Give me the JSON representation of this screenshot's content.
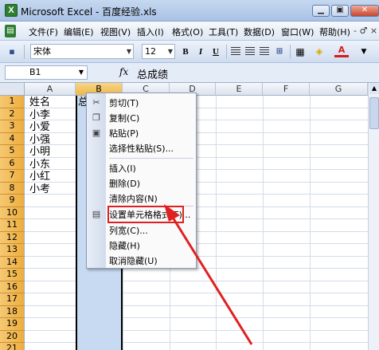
{
  "window": {
    "title": "Microsoft Excel - 百度经验.xls",
    "app_icon": "excel-icon",
    "controls": [
      "minimize",
      "restore",
      "close"
    ]
  },
  "menubar": {
    "items": [
      {
        "label": "文件(F)"
      },
      {
        "label": "编辑(E)"
      },
      {
        "label": "视图(V)"
      },
      {
        "label": "插入(I)"
      },
      {
        "label": "格式(O)"
      },
      {
        "label": "工具(T)"
      },
      {
        "label": "数据(D)"
      },
      {
        "label": "窗口(W)"
      },
      {
        "label": "帮助(H)"
      }
    ],
    "right_controls": "- ♂ ×"
  },
  "toolbar": {
    "font_name": "宋体",
    "font_size": "12",
    "bold": "B",
    "italic": "I",
    "underline": "U",
    "font_color": "A"
  },
  "formula_bar": {
    "name_box": "B1",
    "fx": "fx",
    "value": "总成绩"
  },
  "grid": {
    "columns": [
      "A",
      "B",
      "C",
      "D",
      "E",
      "F",
      "G"
    ],
    "selected_column": "B",
    "rows": [
      "1",
      "2",
      "3",
      "4",
      "5",
      "6",
      "7",
      "8",
      "9",
      "10",
      "11",
      "12",
      "13",
      "14",
      "15",
      "16",
      "17",
      "18",
      "19",
      "20",
      "21"
    ],
    "column_a": [
      "姓名",
      "小李",
      "小爱",
      "小强",
      "小明",
      "小东",
      "小红",
      "小考"
    ],
    "b1_partial": "总"
  },
  "context_menu": {
    "items": [
      {
        "label": "剪切(T)",
        "icon": "scissors-icon"
      },
      {
        "label": "复制(C)",
        "icon": "copy-icon"
      },
      {
        "label": "粘贴(P)",
        "icon": "paste-icon"
      },
      {
        "label": "选择性粘贴(S)..."
      },
      {
        "label": "插入(I)"
      },
      {
        "label": "删除(D)"
      },
      {
        "label": "清除内容(N)"
      },
      {
        "label": "设置单元格格式(F)...",
        "icon": "format-cells-icon",
        "highlighted": true
      },
      {
        "label": "列宽(C)..."
      },
      {
        "label": "隐藏(H)"
      },
      {
        "label": "取消隐藏(U)"
      }
    ]
  },
  "colors": {
    "row_header": "#eeae3c",
    "selection": "#c7daf1",
    "highlight": "#e02020"
  }
}
